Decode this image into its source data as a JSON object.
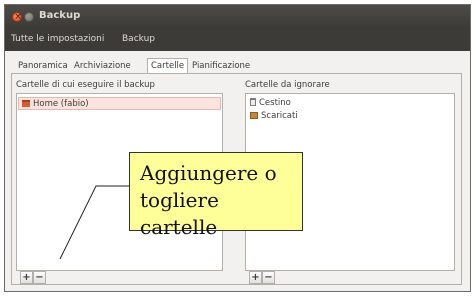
{
  "window": {
    "title": "Backup"
  },
  "menubar": {
    "items": [
      "Tutte le impostazioni",
      "Backup"
    ]
  },
  "tabs": [
    {
      "label": "Panoramica"
    },
    {
      "label": "Archiviazione"
    },
    {
      "label": "Cartelle",
      "active": true
    },
    {
      "label": "Pianificazione"
    }
  ],
  "include_section": {
    "label": "Cartelle di cui eseguire il backup",
    "items": [
      {
        "label": "Home (fabio)",
        "icon": "home-folder-icon",
        "selected": true
      }
    ]
  },
  "exclude_section": {
    "label": "Cartelle da ignorare",
    "items": [
      {
        "label": "Cestino",
        "icon": "trash-icon"
      },
      {
        "label": "Scaricati",
        "icon": "downloads-folder-icon"
      }
    ]
  },
  "buttons": {
    "add": "+",
    "remove": "−"
  },
  "annotation": {
    "line1": "Aggiungere o",
    "line2": "togliere cartelle"
  },
  "colors": {
    "titlebar": "#3c3b37",
    "close_button": "#e05a26",
    "selection": "#fbe3df",
    "callout": "#ffff99"
  }
}
